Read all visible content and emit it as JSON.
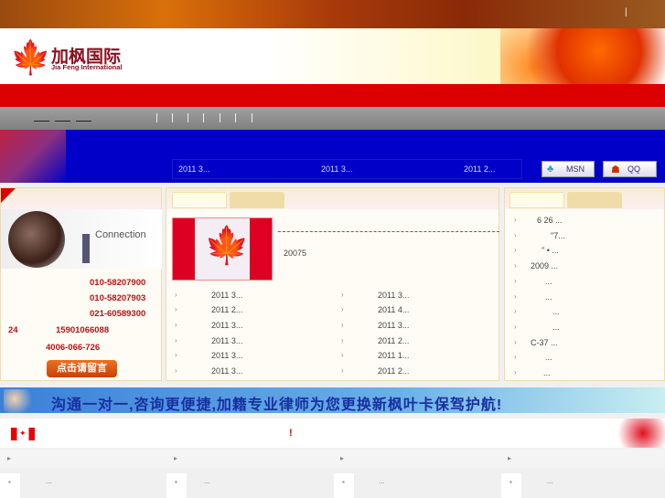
{
  "top": {
    "separator": "|"
  },
  "logo": {
    "cn": "加枫国际",
    "en": "Jia Feng International"
  },
  "ticker": [
    "2011 3...",
    "2011 3...",
    "2011 2..."
  ],
  "contact_buttons": {
    "msn": "MSN",
    "qq": "QQ"
  },
  "left_panel": {
    "image_title": "Connection",
    "phones": [
      "010-58207900",
      "010-58207903",
      "021-60589300",
      "15901066088",
      "4006-066-726"
    ],
    "hotline_label": "24",
    "message_button": "点击请留言"
  },
  "middle_panel": {
    "featured_text": "20075",
    "col1": [
      "2011 3...",
      "2011 2...",
      "2011 3...",
      "2011 3...",
      "2011 3...",
      "2011 3..."
    ],
    "col2": [
      "2011 3...",
      "2011 4...",
      "2011 3...",
      "2011 2...",
      "2011 1...",
      "2011 2..."
    ]
  },
  "right_panel": {
    "items": [
      "6 26 ...",
      "\"7...",
      "\" • ...",
      "2009 ...",
      "...",
      "...",
      "...",
      "...",
      "C-37 ...",
      "...",
      "..."
    ]
  },
  "banner": {
    "slogan": "沟通一对一,咨询更便捷,加籍专业律师为您更换新枫叶卡保驾护航!"
  },
  "section": {
    "mark": "!"
  },
  "bottom": {
    "items": [
      "...",
      "...",
      "...",
      "..."
    ]
  }
}
